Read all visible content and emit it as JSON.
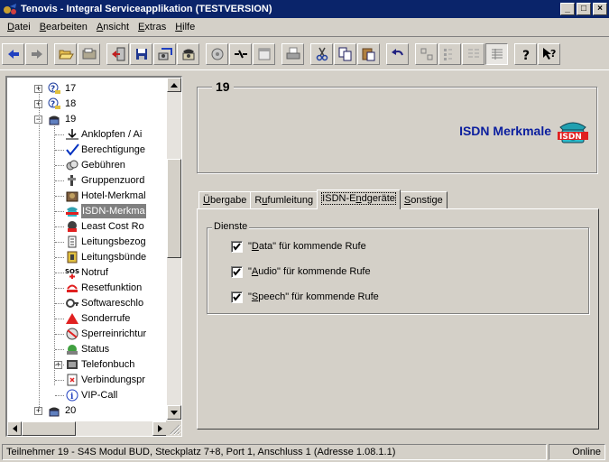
{
  "window": {
    "title": "Tenovis - Integral Serviceapplikation (TESTVERSION)",
    "minimize": "_",
    "maximize": "□",
    "close": "×"
  },
  "menu": [
    {
      "label": "Datei",
      "mnemonic": "D",
      "rest": "atei"
    },
    {
      "label": "Bearbeiten",
      "mnemonic": "B",
      "rest": "earbeiten"
    },
    {
      "label": "Ansicht",
      "mnemonic": "A",
      "rest": "nsicht"
    },
    {
      "label": "Extras",
      "mnemonic": "E",
      "rest": "xtras"
    },
    {
      "label": "Hilfe",
      "mnemonic": "H",
      "rest": "ilfe"
    }
  ],
  "toolbar": {
    "icons": [
      "back-arrow-icon",
      "forward-arrow-icon",
      "open-folder-icon",
      "folder-icon",
      "exit-door-icon",
      "save-icon",
      "copy-pbx-icon",
      "telephone-icon",
      "dial-icon",
      "connect-icon",
      "calendar-icon",
      "print-icon",
      "cut-icon",
      "copy-icon",
      "paste-icon",
      "undo-icon",
      "large-icons-icon",
      "small-icons-icon",
      "list-view-icon",
      "details-view-icon",
      "help-icon",
      "context-help-icon"
    ]
  },
  "tree": {
    "items": [
      {
        "label": "17",
        "level": 0,
        "expander": "+",
        "icon": "question-icon"
      },
      {
        "label": "18",
        "level": 0,
        "expander": "+",
        "icon": "question-icon"
      },
      {
        "label": "19",
        "level": 0,
        "expander": "-",
        "icon": "telephone-set-icon"
      },
      {
        "label": "Anklopfen / Ai",
        "level": 1,
        "icon": "call-waiting-icon"
      },
      {
        "label": "Berechtigunge",
        "level": 1,
        "icon": "checkmark-icon"
      },
      {
        "label": "Gebühren",
        "level": 1,
        "icon": "coins-icon"
      },
      {
        "label": "Gruppenzuord",
        "level": 1,
        "icon": "group-icon"
      },
      {
        "label": "Hotel-Merkmal",
        "level": 1,
        "icon": "hotel-icon"
      },
      {
        "label": "ISDN-Merkma",
        "level": 1,
        "icon": "isdn-icon",
        "selected": true
      },
      {
        "label": "Least Cost Ro",
        "level": 1,
        "icon": "lcr-icon"
      },
      {
        "label": "Leitungsbezog",
        "level": 1,
        "icon": "line-icon"
      },
      {
        "label": "Leitungsbünde",
        "level": 1,
        "icon": "line-bundle-icon"
      },
      {
        "label": "Notruf",
        "level": 1,
        "icon": "sos-icon"
      },
      {
        "label": "Resetfunktion",
        "level": 1,
        "icon": "reset-icon"
      },
      {
        "label": "Softwareschlo",
        "level": 1,
        "icon": "software-lock-icon"
      },
      {
        "label": "Sonderrufe",
        "level": 1,
        "icon": "warning-icon"
      },
      {
        "label": "Sperreinrichtur",
        "level": 1,
        "icon": "lock-icon"
      },
      {
        "label": "Status",
        "level": 1,
        "icon": "status-icon"
      },
      {
        "label": "Telefonbuch",
        "level": 1,
        "expander": "+",
        "icon": "phonebook-icon"
      },
      {
        "label": "Verbindungspr",
        "level": 1,
        "icon": "connection-protocol-icon"
      },
      {
        "label": "VIP-Call",
        "level": 1,
        "icon": "info-icon"
      },
      {
        "label": "20",
        "level": 0,
        "expander": "+",
        "icon": "telephone-set-icon"
      }
    ]
  },
  "header": {
    "number": "19",
    "title": "ISDN Merkmale"
  },
  "tabs": [
    {
      "label": "Übergabe",
      "mnemonic": "Ü",
      "rest": "bergabe"
    },
    {
      "label": "Rufumleitung",
      "pre": "R",
      "mnemonic": "u",
      "rest": "fumleitung"
    },
    {
      "label": "ISDN-Endgeräte",
      "pre": "ISDN-E",
      "mnemonic": "n",
      "rest": "dgeräte",
      "active": true
    },
    {
      "label": "Sonstige",
      "mnemonic": "S",
      "rest": "onstige"
    }
  ],
  "dienste": {
    "legend": "Dienste",
    "options": [
      {
        "pre": "\"",
        "mnemonic": "D",
        "rest": "ata\" für kommende Rufe",
        "checked": true
      },
      {
        "pre": "\"",
        "mnemonic": "A",
        "rest": "udio\" für kommende Rufe",
        "checked": true
      },
      {
        "pre": "\"",
        "mnemonic": "S",
        "rest": "peech\" für kommende Rufe",
        "checked": true
      }
    ]
  },
  "status": {
    "main": "Teilnehmer 19 - S4S Modul BUD, Steckplatz 7+8, Port 1, Anschluss 1 (Adresse 1.08.1.1)",
    "online": "Online"
  },
  "colors": {
    "titlebar": "#0a246a",
    "face": "#d4d0c8",
    "header_title": "#0b1e9e",
    "selection": "#808080"
  }
}
